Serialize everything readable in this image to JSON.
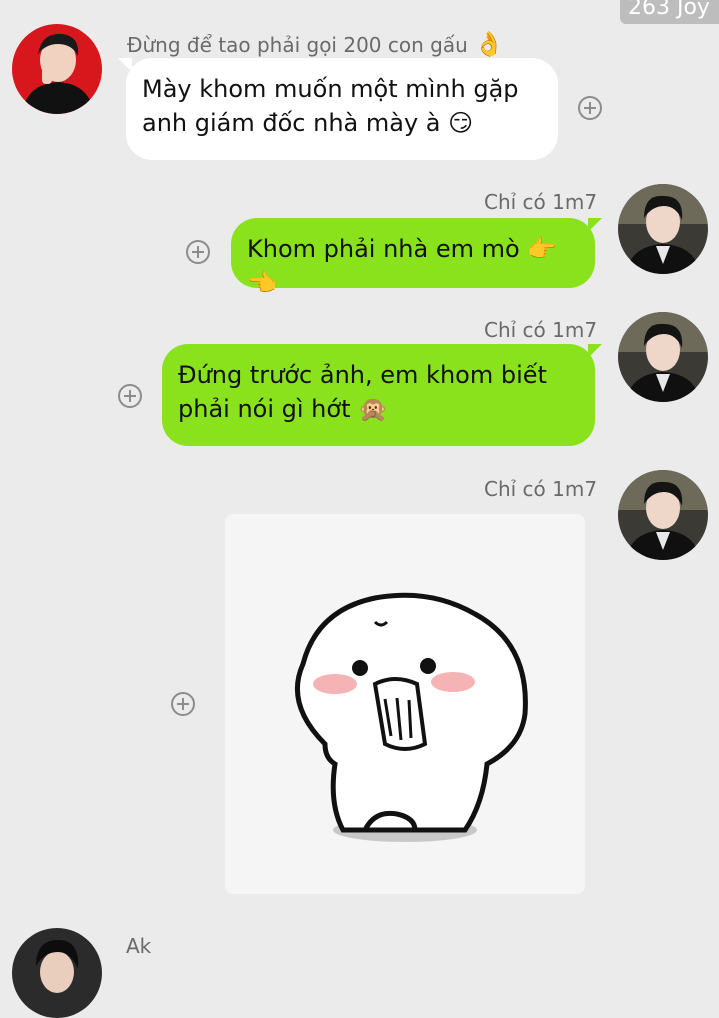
{
  "header": {
    "badge": "263 Joy"
  },
  "messages": [
    {
      "sender": "Đừng để tao phải gọi 200 con gấu",
      "sender_emoji": "👌",
      "side": "left",
      "lines": [
        "Mày khom muốn một mình gặp",
        "anh giám đốc nhà mày à"
      ],
      "emoji": "😏"
    },
    {
      "sender": "Chỉ có 1m7",
      "side": "right",
      "lines": [
        "Khom phải nhà em mò"
      ],
      "emoji": "👉👈"
    },
    {
      "sender": "Chỉ có 1m7",
      "side": "right",
      "lines": [
        "Đứng trước ảnh, em khom biết",
        "phải nói gì hớt"
      ],
      "emoji": "🙊"
    },
    {
      "sender": "Chỉ có 1m7",
      "side": "right",
      "type": "sticker",
      "sticker": "shy-dumpling-sticker"
    },
    {
      "sender": "Ak",
      "side": "left"
    }
  ],
  "colors": {
    "incoming_bubble": "#ffffff",
    "outgoing_bubble": "#8ae21c",
    "background": "#ebebeb"
  }
}
